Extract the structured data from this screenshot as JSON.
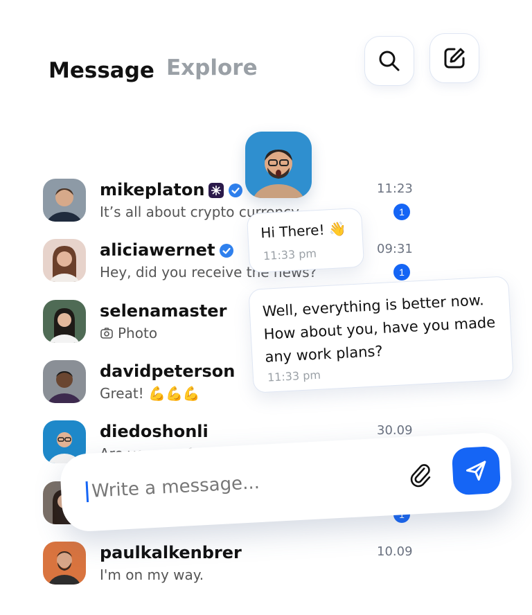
{
  "tabs": {
    "message": "Message",
    "explore": "Explore"
  },
  "icons": {
    "search": "search-icon",
    "compose": "compose-icon",
    "attach": "paperclip-icon",
    "send": "send-icon"
  },
  "colors": {
    "accent": "#1565f5",
    "verified": "#2f80ed",
    "badge_dark": "#2b1a4a"
  },
  "conversations": [
    {
      "username": "mikeplaton",
      "preview": "It’s all about crypto currency",
      "time": "11:23",
      "unread": "1"
    },
    {
      "username": "aliciawernet",
      "preview": "Hey, did you receive the news?",
      "time": "09:31",
      "unread": "1"
    },
    {
      "username": "selenamaster",
      "preview": "Photo",
      "time": "",
      "unread": ""
    },
    {
      "username": "davidpeterson",
      "preview": "Great! 💪💪💪",
      "time": "",
      "unread": ""
    },
    {
      "username": "diedoshonli",
      "preview": "Are you sure?",
      "time": "30.09",
      "unread": ""
    },
    {
      "username": "",
      "preview": "",
      "time": "",
      "unread": "1"
    },
    {
      "username": "paulkalkenbrer",
      "preview": "I'm on my way.",
      "time": "10.09",
      "unread": ""
    }
  ],
  "chat": {
    "bubble1": {
      "text": "Hi There! 👋",
      "time": "11:33 pm"
    },
    "bubble2": {
      "text": "Well, everything is better now. How about you, have you made any work plans?",
      "time": "11:33 pm"
    }
  },
  "composer": {
    "placeholder": "Write a message..."
  }
}
